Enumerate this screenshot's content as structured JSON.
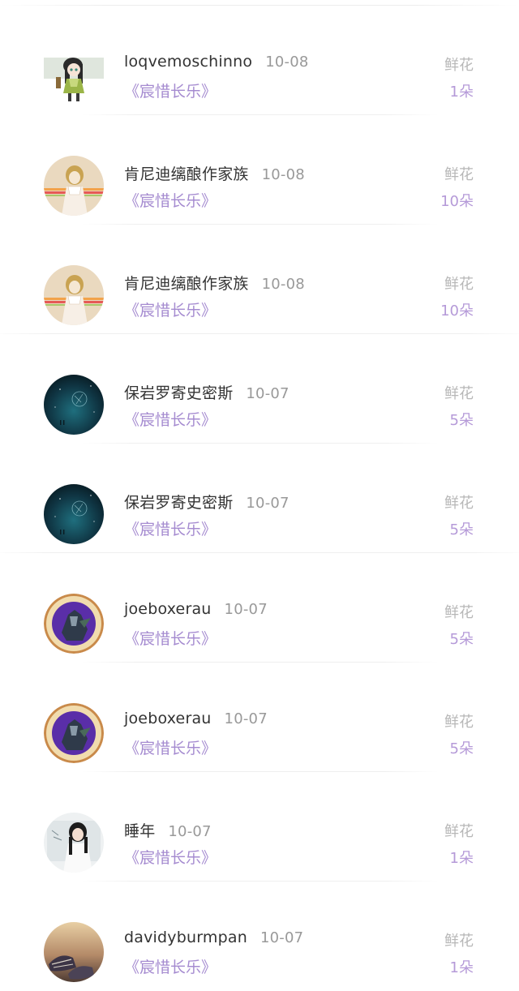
{
  "gift_list": {
    "items": [
      {
        "name": "loqvemoschinno",
        "date": "10-08",
        "book": "《宸惜长乐》",
        "gift_label": "鲜花",
        "gift_count": "1朵"
      },
      {
        "name": "肯尼迪缡酿作家族",
        "date": "10-08",
        "book": "《宸惜长乐》",
        "gift_label": "鲜花",
        "gift_count": "10朵"
      },
      {
        "name": "肯尼迪缡酿作家族",
        "date": "10-08",
        "book": "《宸惜长乐》",
        "gift_label": "鲜花",
        "gift_count": "10朵"
      },
      {
        "name": "保岩罗寄史密斯",
        "date": "10-07",
        "book": "《宸惜长乐》",
        "gift_label": "鲜花",
        "gift_count": "5朵"
      },
      {
        "name": "保岩罗寄史密斯",
        "date": "10-07",
        "book": "《宸惜长乐》",
        "gift_label": "鲜花",
        "gift_count": "5朵"
      },
      {
        "name": "joeboxerau",
        "date": "10-07",
        "book": "《宸惜长乐》",
        "gift_label": "鲜花",
        "gift_count": "5朵"
      },
      {
        "name": "joeboxerau",
        "date": "10-07",
        "book": "《宸惜长乐》",
        "gift_label": "鲜花",
        "gift_count": "5朵"
      },
      {
        "name": "睡年",
        "date": "10-07",
        "book": "《宸惜长乐》",
        "gift_label": "鲜花",
        "gift_count": "1朵"
      },
      {
        "name": "davidyburmpan",
        "date": "10-07",
        "book": "《宸惜长乐》",
        "gift_label": "鲜花",
        "gift_count": "1朵"
      }
    ]
  }
}
